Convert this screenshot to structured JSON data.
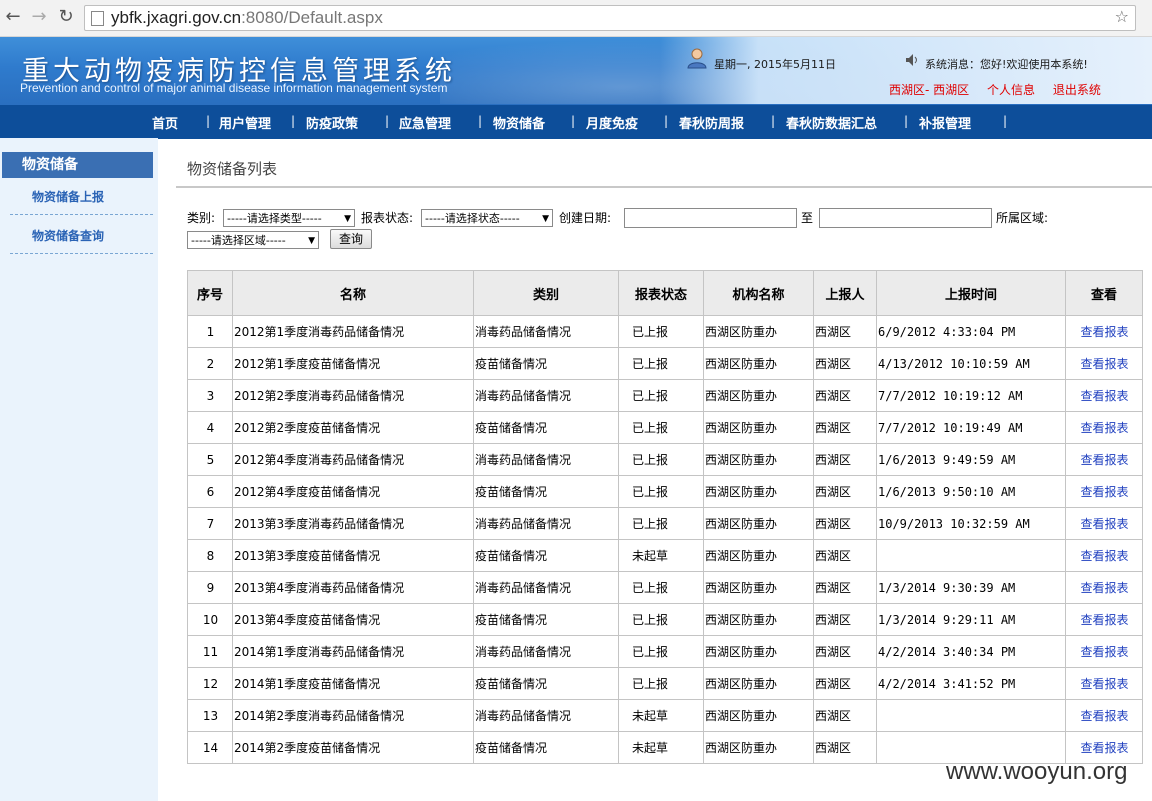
{
  "browser": {
    "url_host": "ybfk.jxagri.gov.cn",
    "url_rest": ":8080/Default.aspx"
  },
  "header": {
    "title": "重大动物疫病防控信息管理系统",
    "subtitle": "Prevention and control of major animal disease information management system",
    "date": "星期一, 2015年5月11日",
    "system_message": "系统消息：您好!欢迎使用本系统!",
    "links": [
      "西湖区- 西湖区",
      "个人信息",
      "退出系统"
    ]
  },
  "nav": [
    "首页",
    "用户管理",
    "防疫政策",
    "应急管理",
    "物资储备",
    "月度免疫",
    "春秋防周报",
    "春秋防数据汇总",
    "补报管理"
  ],
  "sidebar": {
    "heading": "物资储备",
    "items": [
      "物资储备上报",
      "物资储备查询"
    ]
  },
  "main": {
    "title": "物资储备列表",
    "filters": {
      "category_label": "类别:",
      "category_value": "-----请选择类型-----",
      "status_label": "报表状态:",
      "status_value": "-----请选择状态-----",
      "date_label": "创建日期:",
      "date_to": "至",
      "region_label": "所属区域:",
      "region_value": "-----请选择区域-----",
      "search_button": "查询"
    },
    "table": {
      "headers": [
        "序号",
        "名称",
        "类别",
        "报表状态",
        "机构名称",
        "上报人",
        "上报时间",
        "查看"
      ],
      "rows": [
        [
          "1",
          "2012第1季度消毒药品储备情况",
          "消毒药品储备情况",
          "已上报",
          "西湖区防重办",
          "西湖区",
          "6/9/2012 4:33:04 PM",
          "查看报表"
        ],
        [
          "2",
          "2012第1季度疫苗储备情况",
          "疫苗储备情况",
          "已上报",
          "西湖区防重办",
          "西湖区",
          "4/13/2012 10:10:59 AM",
          "查看报表"
        ],
        [
          "3",
          "2012第2季度消毒药品储备情况",
          "消毒药品储备情况",
          "已上报",
          "西湖区防重办",
          "西湖区",
          "7/7/2012 10:19:12 AM",
          "查看报表"
        ],
        [
          "4",
          "2012第2季度疫苗储备情况",
          "疫苗储备情况",
          "已上报",
          "西湖区防重办",
          "西湖区",
          "7/7/2012 10:19:49 AM",
          "查看报表"
        ],
        [
          "5",
          "2012第4季度消毒药品储备情况",
          "消毒药品储备情况",
          "已上报",
          "西湖区防重办",
          "西湖区",
          "1/6/2013 9:49:59 AM",
          "查看报表"
        ],
        [
          "6",
          "2012第4季度疫苗储备情况",
          "疫苗储备情况",
          "已上报",
          "西湖区防重办",
          "西湖区",
          "1/6/2013 9:50:10 AM",
          "查看报表"
        ],
        [
          "7",
          "2013第3季度消毒药品储备情况",
          "消毒药品储备情况",
          "已上报",
          "西湖区防重办",
          "西湖区",
          "10/9/2013 10:32:59 AM",
          "查看报表"
        ],
        [
          "8",
          "2013第3季度疫苗储备情况",
          "疫苗储备情况",
          "未起草",
          "西湖区防重办",
          "西湖区",
          "",
          "查看报表"
        ],
        [
          "9",
          "2013第4季度消毒药品储备情况",
          "消毒药品储备情况",
          "已上报",
          "西湖区防重办",
          "西湖区",
          "1/3/2014 9:30:39 AM",
          "查看报表"
        ],
        [
          "10",
          "2013第4季度疫苗储备情况",
          "疫苗储备情况",
          "已上报",
          "西湖区防重办",
          "西湖区",
          "1/3/2014 9:29:11 AM",
          "查看报表"
        ],
        [
          "11",
          "2014第1季度消毒药品储备情况",
          "消毒药品储备情况",
          "已上报",
          "西湖区防重办",
          "西湖区",
          "4/2/2014 3:40:34 PM",
          "查看报表"
        ],
        [
          "12",
          "2014第1季度疫苗储备情况",
          "疫苗储备情况",
          "已上报",
          "西湖区防重办",
          "西湖区",
          "4/2/2014 3:41:52 PM",
          "查看报表"
        ],
        [
          "13",
          "2014第2季度消毒药品储备情况",
          "消毒药品储备情况",
          "未起草",
          "西湖区防重办",
          "西湖区",
          "",
          "查看报表"
        ],
        [
          "14",
          "2014第2季度疫苗储备情况",
          "疫苗储备情况",
          "未起草",
          "西湖区防重办",
          "西湖区",
          "",
          "查看报表"
        ]
      ]
    }
  },
  "watermark": "www.wooyun.org",
  "colors": {
    "nav_bg": "#0d4e9a",
    "sidebar_bg": "#eaf3fc",
    "sidebar_head": "#3a6fb3",
    "link": "#1f3fbf",
    "header_link": "#e00000"
  }
}
